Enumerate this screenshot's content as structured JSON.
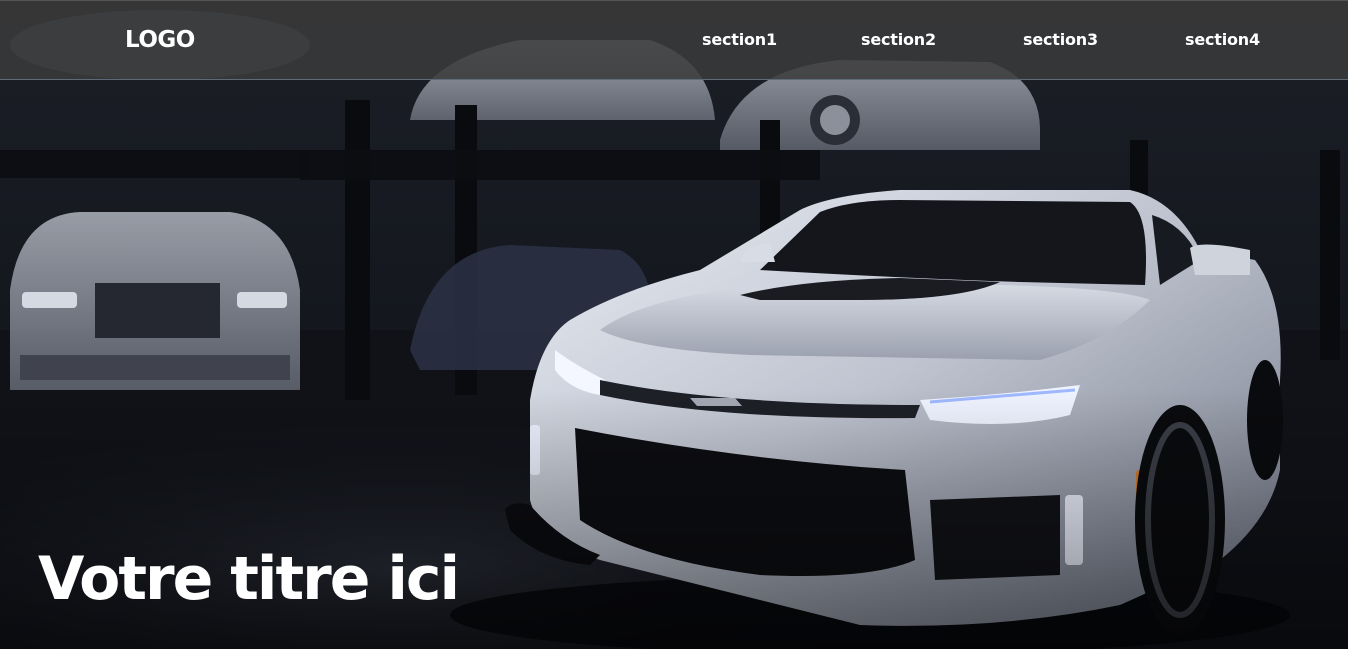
{
  "navbar": {
    "logo": "LOGO",
    "links": [
      {
        "label": "section1"
      },
      {
        "label": "section2"
      },
      {
        "label": "section3"
      },
      {
        "label": "section4"
      }
    ]
  },
  "hero": {
    "title": "Votre titre ici",
    "background_image_subject": "car-photo"
  },
  "colors": {
    "navbar_bg": "#3a3a3a",
    "text": "#ffffff",
    "background": "#0d0f14"
  }
}
